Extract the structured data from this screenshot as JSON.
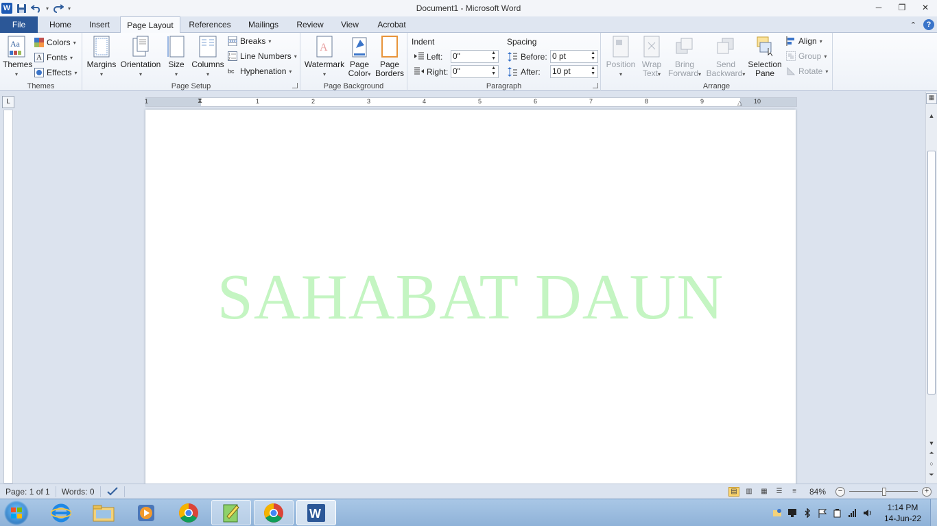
{
  "window": {
    "title": "Document1  -  Microsoft Word",
    "minimize": "─",
    "restore": "❐",
    "close": "✕"
  },
  "qat": {
    "app_icon": "W",
    "undo_dropdown": "▾",
    "customize": "▾"
  },
  "tabs": [
    {
      "label": "File"
    },
    {
      "label": "Home"
    },
    {
      "label": "Insert"
    },
    {
      "label": "Page Layout"
    },
    {
      "label": "References"
    },
    {
      "label": "Mailings"
    },
    {
      "label": "Review"
    },
    {
      "label": "View"
    },
    {
      "label": "Acrobat"
    }
  ],
  "ribbon_controls": {
    "minimize": "⌃",
    "help": "?"
  },
  "ribbon": {
    "themes": {
      "title": "Themes",
      "themes_label": "Themes",
      "colors": "Colors",
      "fonts": "Fonts",
      "effects": "Effects"
    },
    "page_setup": {
      "title": "Page Setup",
      "margins": "Margins",
      "orientation": "Orientation",
      "size": "Size",
      "columns": "Columns",
      "breaks": "Breaks",
      "line_numbers": "Line Numbers",
      "hyphenation": "Hyphenation"
    },
    "page_background": {
      "title": "Page Background",
      "watermark": "Watermark",
      "page_color_1": "Page",
      "page_color_2": "Color",
      "page_borders_1": "Page",
      "page_borders_2": "Borders"
    },
    "paragraph": {
      "title": "Paragraph",
      "indent": "Indent",
      "left_label": "Left:",
      "left_value": "0\"",
      "right_label": "Right:",
      "right_value": "0\"",
      "spacing": "Spacing",
      "before_label": "Before:",
      "before_value": "0 pt",
      "after_label": "After:",
      "after_value": "10 pt"
    },
    "arrange": {
      "title": "Arrange",
      "position": "Position",
      "wrap_1": "Wrap",
      "wrap_2": "Text",
      "bring_1": "Bring",
      "bring_2": "Forward",
      "send_1": "Send",
      "send_2": "Backward",
      "selection_1": "Selection",
      "selection_2": "Pane",
      "align": "Align",
      "group": "Group",
      "rotate": "Rotate"
    }
  },
  "ruler": {
    "tab_selector": "L",
    "numbers": [
      "1",
      "1",
      "2",
      "3",
      "4",
      "5",
      "6",
      "7",
      "8",
      "9",
      "10"
    ]
  },
  "document": {
    "watermark_text": "SAHABAT DAUN",
    "watermark_color": "#c4f5c2"
  },
  "status": {
    "page": "Page: 1 of 1",
    "words": "Words: 0",
    "zoom": "84%",
    "zoom_out": "−",
    "zoom_in": "+"
  },
  "taskbar": {
    "time": "1:14 PM",
    "date": "14-Jun-22"
  }
}
